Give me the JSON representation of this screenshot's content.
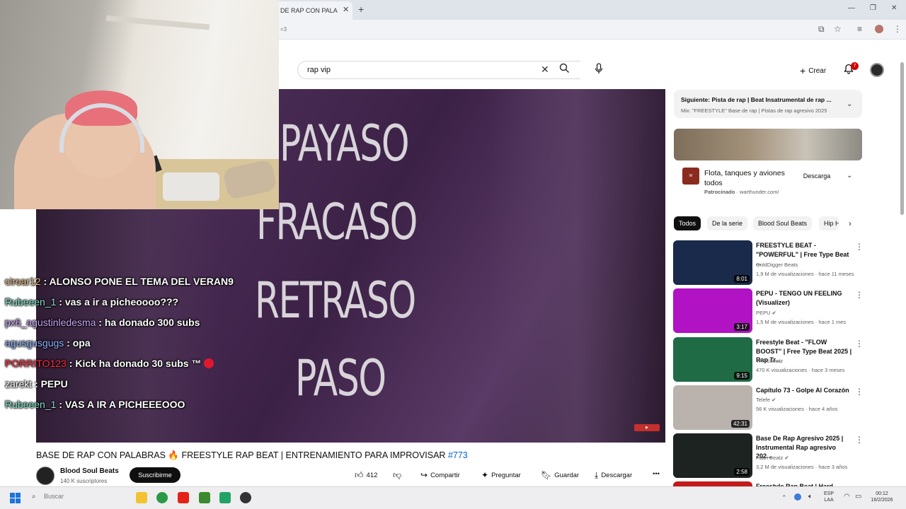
{
  "browser": {
    "tab_title": "DE RAP CON PALA",
    "tab_close": "✕",
    "new_tab": "+",
    "url_fragment": "=3",
    "window_controls": [
      "—",
      "❐",
      "✕"
    ]
  },
  "header": {
    "search_value": "rap vip",
    "create_label": "Crear",
    "notifications_count": "7"
  },
  "chat": [
    {
      "user": "ciroar12",
      "color": "#e6b97a",
      "msg": " : ALONSO PONE EL TEMA DEL VERAN9"
    },
    {
      "user": "Rubeeen_1",
      "color": "#7fe3c7",
      "msg": " : vas a ir a picheoooo???"
    },
    {
      "user": "px6_agustinledesma",
      "color": "#c7a4f0",
      "msg": " : ha donado 300 subs"
    },
    {
      "user": "agusgusgugs",
      "color": "#8fb4ff",
      "msg": " : opa"
    },
    {
      "user": "PORRITO123",
      "color": "#ff2a3a",
      "msg": " : Kick ha donado 30 subs ™"
    },
    {
      "user": "zarekt",
      "color": "#ffffff",
      "msg": " : PEPU"
    },
    {
      "user": "Rubeeen_1",
      "color": "#7fe3c7",
      "msg": " : VAS A IR A PICHEEEOOO"
    }
  ],
  "video": {
    "lyrics": [
      "PAYASO",
      "FRACASO",
      "RETRASO",
      "PASO"
    ],
    "title": "BASE DE RAP CON PALABRAS 🔥 FREESTYLE RAP BEAT | ENTRENAMIENTO PARA IMPROVISAR",
    "hashtag": "#773",
    "channel": "Blood Soul Beats",
    "subscribers": "140 K suscriptores",
    "subscribe_label": "Suscribirme",
    "likes": "412",
    "share_label": "Compartir",
    "ask_label": "Preguntar",
    "save_label": "Guardar",
    "download_label": "Descargar",
    "more": "•••"
  },
  "sidebar": {
    "next_title": "Siguiente: Pista de rap | Beat Insatrumental de rap ...",
    "next_sub": "Mix: \"FREESTYLE\" Base de rap | Pistas de rap agresivo 2025",
    "ad_title": "Flota, tanques y aviones todos",
    "ad_sponsor": "Patrocinado",
    "ad_domain": " · warthunder.com/",
    "ad_button": "Descarga",
    "chips": [
      "Todos",
      "De la serie",
      "Blood Soul Beats",
      "Hip H"
    ],
    "recs": [
      {
        "title": "FREESTYLE BEAT - \"POWERFUL\" | Free Type Beat ...",
        "channel": "GoldDigger Beats",
        "meta": "1,9 M de visualizaciones · hace 11 meses",
        "duration": "8:01",
        "thumb": "#1a2a4a"
      },
      {
        "title": "PEPU - TENGO UN FEELING (Visualizer)",
        "channel": "PEPU ✔",
        "meta": "1,5 M de visualizaciones · hace 1 mes",
        "duration": "3:17",
        "thumb": "#b012c4"
      },
      {
        "title": "Freestyle Beat - \"FLOW BOOST\" | Free Type Beat 2025 | Rap Tr...",
        "channel": "YAR1Beatz",
        "meta": "470 K visualizaciones · hace 3 meses",
        "duration": "9:15",
        "thumb": "#1f6b45"
      },
      {
        "title": "Capítulo 73 - Golpe Al Corazón",
        "channel": "Telefe ✔",
        "meta": "56 K visualizaciones · hace 4 años",
        "duration": "42:31",
        "thumb": "#b9b2ad"
      },
      {
        "title": "Base De Rap Agresivo 2025 | Instrumental Rap agresivo 202...",
        "channel": "Fabri Beatz ✔",
        "meta": "3,2 M de visualizaciones · hace 3 años",
        "duration": "2:58",
        "thumb": "#1d2320"
      },
      {
        "title": "Freestyle Rap Beat | Hard Boom...",
        "channel": "",
        "meta": "",
        "duration": "",
        "thumb": "#c21a1a"
      }
    ]
  },
  "taskbar": {
    "search_placeholder": "Buscar",
    "lang": "ESP",
    "lang2": "LAA",
    "time": "00:12",
    "date": "16/2/2026"
  }
}
